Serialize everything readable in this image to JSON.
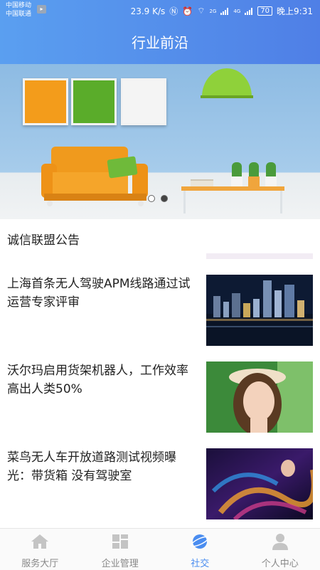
{
  "status_bar": {
    "carrier1": "中国移动",
    "carrier2": "中国联通",
    "speed": "23.9 K/s",
    "signal1": "2G",
    "signal2": "4G",
    "battery": "70",
    "time": "晚上9:31"
  },
  "header": {
    "title": "行业前沿"
  },
  "banner": {
    "active_index": 1,
    "page_count": 2
  },
  "notice": {
    "title": "诚信联盟公告"
  },
  "news": [
    {
      "title": "上海首条无人驾驶APM线路通过试运营专家评审",
      "image": "city-night-photo"
    },
    {
      "title": "沃尔玛启用货架机器人，工作效率高出人类50%",
      "image": "woman-flower-crown-photo"
    },
    {
      "title": "菜鸟无人车开放道路测试视频曝光：带货箱 没有驾驶室",
      "image": "colorful-dancer-photo"
    }
  ],
  "tabs": [
    {
      "label": "服务大厅",
      "icon": "home-icon",
      "active": false
    },
    {
      "label": "企业管理",
      "icon": "grid-icon",
      "active": false
    },
    {
      "label": "社交",
      "icon": "planet-icon",
      "active": true
    },
    {
      "label": "个人中心",
      "icon": "person-icon",
      "active": false
    }
  ],
  "colors": {
    "accent": "#4a8df0",
    "header_start": "#5a9ff0",
    "header_end": "#4f7fe6"
  }
}
